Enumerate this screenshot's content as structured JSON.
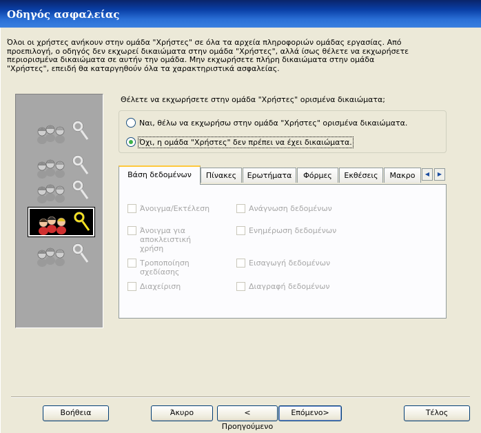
{
  "window": {
    "title": "Οδηγός ασφαλείας"
  },
  "intro": {
    "lines": [
      "Όλοι οι χρήστες ανήκουν στην ομάδα \"Χρήστες\" σε όλα τα αρχεία πληροφοριών ομάδας εργασίας. Από",
      "προεπιλογή, ο οδηγός δεν εκχωρεί δικαιώματα στην ομάδα \"Χρήστες\", αλλά ίσως θέλετε να εκχωρήσετε",
      "περιορισμένα δικαιώματα σε αυτήν την ομάδα. Μην εκχωρήσετε πλήρη δικαιώματα στην ομάδα",
      "\"Χρήστες\", επειδή θα καταργηθούν όλα τα χαρακτηριστικά ασφαλείας."
    ]
  },
  "question": "Θέλετε να εκχωρήσετε στην ομάδα \"Χρήστες\" ορισμένα δικαιώματα;",
  "options": [
    {
      "label": "Ναι, θέλω να εκχωρήσω στην ομάδα \"Χρήστες\" ορισμένα δικαιώματα.",
      "checked": false
    },
    {
      "label": "Όχι, η ομάδα \"Χρήστες\" δεν πρέπει να έχει δικαιώματα.",
      "checked": true
    }
  ],
  "tabs": [
    "Βάση δεδομένων",
    "Πίνακες",
    "Ερωτήματα",
    "Φόρμες",
    "Εκθέσεις",
    "Μακρο"
  ],
  "active_tab": 0,
  "tab_scroll": {
    "left": "◀",
    "right": "▶"
  },
  "permissions": {
    "left": [
      "Άνοιγμα/Εκτέλεση",
      "Άνοιγμα για αποκλειστική χρήση",
      "Τροποποίηση σχεδίασης",
      "Διαχείριση"
    ],
    "right": [
      "Ανάγνωση δεδομένων",
      "Ενημέρωση δεδομένων",
      "Εισαγωγή δεδομένων",
      "Διαγραφή δεδομένων"
    ]
  },
  "buttons": {
    "help": "Βοήθεια",
    "cancel": "Άκυρο",
    "back": "< Προηγούμενο",
    "next": "Επόμενο>",
    "finish": "Τέλος"
  },
  "steps": [
    {
      "icon": "users-key-icon",
      "active": false
    },
    {
      "icon": "users-key-icon",
      "active": false
    },
    {
      "icon": "users-key-icon",
      "active": false
    },
    {
      "icon": "users-key-icon",
      "active": true
    },
    {
      "icon": "users-key-icon",
      "active": false
    }
  ],
  "colors": {
    "title_bar": "#0a3fa6",
    "radio_check": "#3fb24a",
    "active_tab_top": "#ffc83c",
    "key_active": "#f4e020"
  }
}
